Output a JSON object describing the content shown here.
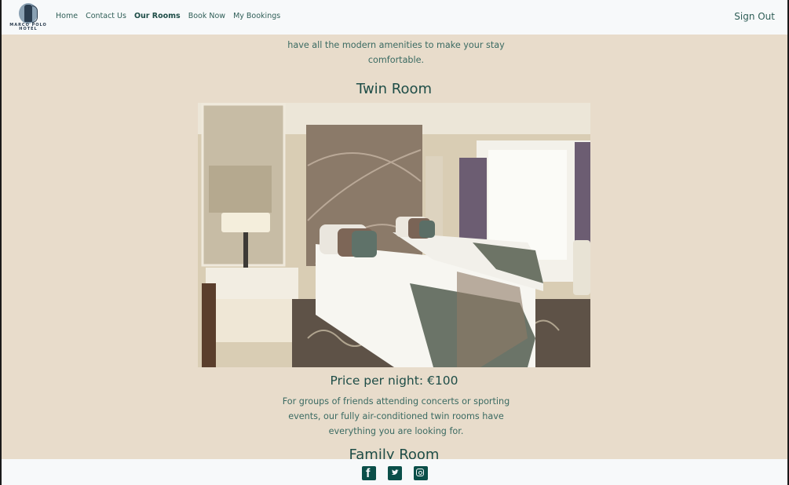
{
  "nav": {
    "logo_text": "MARCO POLO HOTEL",
    "links": [
      {
        "label": "Home",
        "active": false
      },
      {
        "label": "Contact Us",
        "active": false
      },
      {
        "label": "Our Rooms",
        "active": true
      },
      {
        "label": "Book Now",
        "active": false
      },
      {
        "label": "My Bookings",
        "active": false
      }
    ],
    "sign_out": "Sign Out"
  },
  "main": {
    "intro_text": "have all the modern amenities to make your stay comfortable.",
    "rooms": [
      {
        "title": "Twin Room",
        "price": "Price per night: €100",
        "description": "For groups of friends attending concerts or sporting events, our fully air-conditioned twin rooms have everything you are looking for."
      },
      {
        "title": "Family Room"
      }
    ]
  },
  "footer": {
    "social": [
      "facebook-icon",
      "twitter-icon",
      "instagram-icon"
    ]
  },
  "colors": {
    "background": "#e8dccb",
    "nav_bg": "#f7f9fa",
    "text_primary": "#1e4d47",
    "icon": "#0b4f49"
  }
}
